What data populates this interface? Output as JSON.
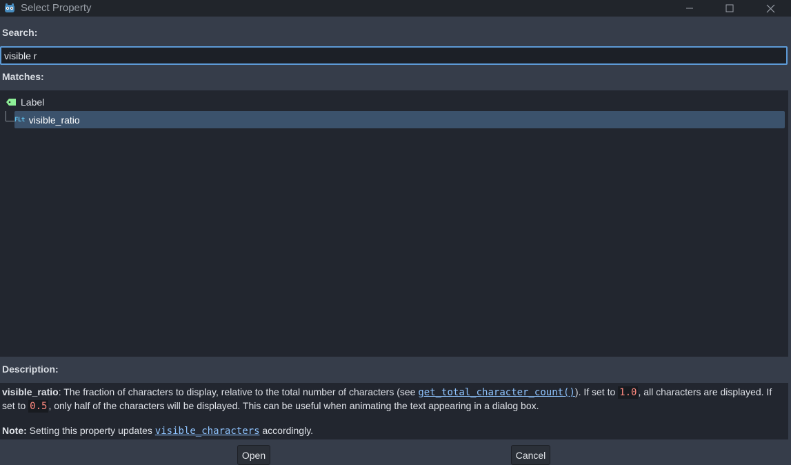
{
  "window": {
    "title": "Select Property",
    "app_icon": "godot-icon",
    "controls": [
      "minimize-icon",
      "maximize-icon",
      "close-icon"
    ]
  },
  "search": {
    "label": "Search:",
    "value": "visible r"
  },
  "matches": {
    "label": "Matches:",
    "tree": {
      "parent": {
        "icon": "label-node-icon",
        "label": "Label"
      },
      "child": {
        "icon": "float-type-icon",
        "type_text": "FLt",
        "label": "visible_ratio",
        "selected": true
      }
    }
  },
  "description": {
    "label": "Description:",
    "property": "visible_ratio",
    "text_a": ": The fraction of characters to display, relative to the total number of characters (see ",
    "method_link": "get_total_character_count()",
    "text_b": "). If set to ",
    "value_1": "1.0",
    "text_c": ", all characters are displayed. If set to ",
    "value_2": "0.5",
    "text_d": ", only half of the characters will be displayed. This can be useful when animating the text appearing in a dialog box.",
    "note_label": "Note:",
    "note_text_a": " Setting this property updates ",
    "note_link": "visible_characters",
    "note_text_b": " accordingly."
  },
  "buttons": {
    "open": "Open",
    "cancel": "Cancel"
  },
  "colors": {
    "accent": "#5d9ad6",
    "selection": "#3b526c",
    "panel_bg": "#22262f",
    "window_bg": "#363d4a",
    "code_value": "#ff8a80",
    "link": "#8fc4ff"
  }
}
